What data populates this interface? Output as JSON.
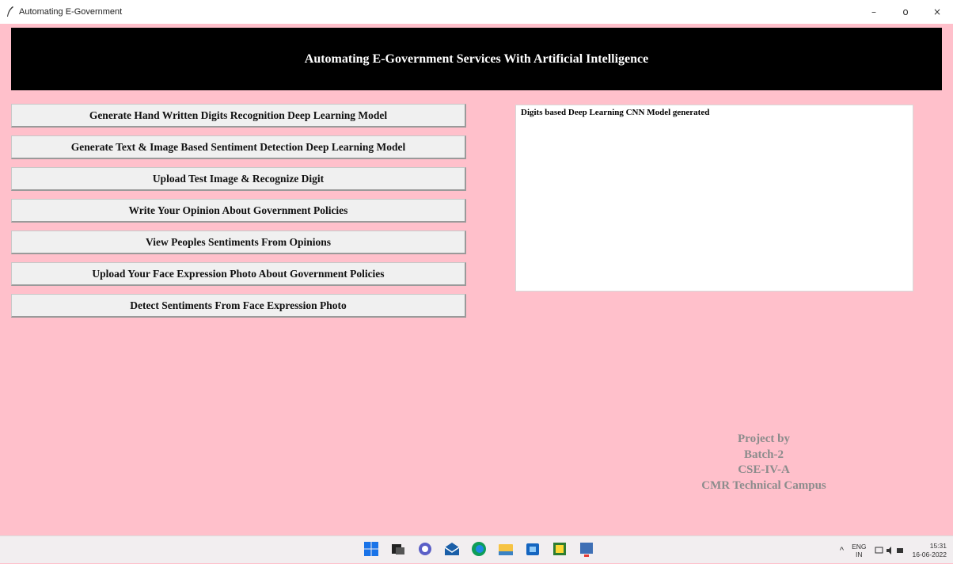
{
  "window": {
    "title": "Automating E-Government",
    "minimize": "–",
    "maximize": "o",
    "close": "×"
  },
  "banner": {
    "title": "Automating E-Government Services With Artificial Intelligence"
  },
  "buttons": [
    {
      "label": "Generate Hand Written Digits Recognition Deep Learning Model"
    },
    {
      "label": "Generate Text & Image Based Sentiment Detection Deep Learning Model"
    },
    {
      "label": "Upload Test Image & Recognize Digit"
    },
    {
      "label": "Write Your Opinion About Government Policies"
    },
    {
      "label": "View Peoples Sentiments From Opinions"
    },
    {
      "label": "Upload Your Face Expression Photo About Government Policies"
    },
    {
      "label": "Detect Sentiments From Face Expression Photo"
    }
  ],
  "output": {
    "text": "Digits based Deep Learning CNN Model generated"
  },
  "credits": {
    "line1": "Project by",
    "line2": "Batch-2",
    "line3": "CSE-IV-A",
    "line4": "CMR Technical Campus"
  },
  "taskbar": {
    "apps": [
      "start-icon",
      "task-view-icon",
      "chat-icon",
      "mail-icon",
      "edge-icon",
      "file-explorer-icon",
      "store-icon",
      "app-icon",
      "python-icon"
    ],
    "tray": {
      "chevron": "^",
      "lang_top": "ENG",
      "lang_bottom": "IN",
      "time": "15:31",
      "date": "16-06-2022"
    }
  }
}
